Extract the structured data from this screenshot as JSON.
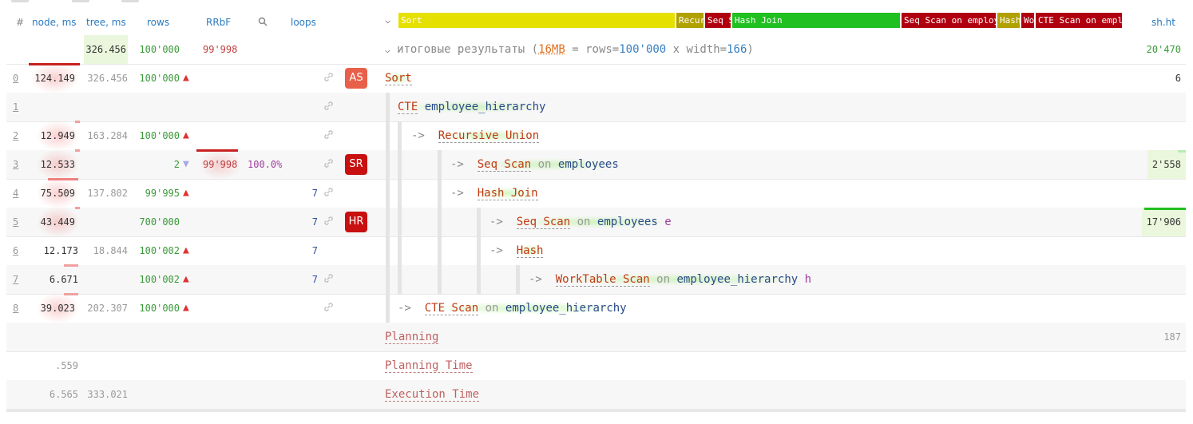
{
  "header": {
    "idx": "#",
    "node_ms": "node, ms",
    "tree_ms": "tree, ms",
    "rows": "rows",
    "rrbf": "RRbF",
    "loops": "loops",
    "shht": "sh.ht"
  },
  "timeline": [
    {
      "label": "Sort",
      "color": "#e6e000"
    },
    {
      "label": "Recur",
      "color": "#b0a000"
    },
    {
      "label": "Seq Scan",
      "color": "#b00010"
    },
    {
      "label": "Hash Join",
      "color": "#20c020"
    },
    {
      "label": "Seq Scan on employees e",
      "color": "#b00010"
    },
    {
      "label": "Hash",
      "color": "#b0a000"
    },
    {
      "label": "WorkTable Scan",
      "color": "#b00010"
    },
    {
      "label": "CTE Scan on employee_hierarchy",
      "color": "#b00010"
    }
  ],
  "summary": {
    "tree": "326.456",
    "rows": "100'000",
    "rrbf": "99'998",
    "text_prefix": "итоговые результаты (",
    "mem": "16MB",
    "eq1": " = rows=",
    "rows_val": "100'000",
    "mul": " x width=",
    "width_val": "166",
    "close": ")",
    "shht": "20'470"
  },
  "rows": [
    {
      "idx": "0",
      "node": "124.149",
      "tree": "326.456",
      "rows": "100'000",
      "dir": "▲",
      "badge": "AS",
      "badge_color": "#e8604a",
      "op": "Sort",
      "shht": "6"
    },
    {
      "idx": "1",
      "op": "CTE",
      "obj": "employee_hierarchy"
    },
    {
      "idx": "2",
      "node": "12.949",
      "tree": "163.284",
      "rows": "100'000",
      "dir": "▲",
      "arrow": "->",
      "op": "Recursive Union"
    },
    {
      "idx": "3",
      "node": "12.533",
      "rows": "2",
      "dir": "▼",
      "rrbf": "99'998",
      "pct": "100.0%",
      "badge": "SR",
      "badge_color": "#c81010",
      "arrow": "->",
      "op": "Seq Scan",
      "kw": "on",
      "obj": "employees",
      "shht": "2'558"
    },
    {
      "idx": "4",
      "node": "75.509",
      "tree": "137.802",
      "rows": "99'995",
      "dir": "▲",
      "loops": "7",
      "arrow": "->",
      "op": "Hash Join"
    },
    {
      "idx": "5",
      "node": "43.449",
      "rows": "700'000",
      "loops": "7",
      "badge": "HR",
      "badge_color": "#c81010",
      "arrow": "->",
      "op": "Seq Scan",
      "kw": "on",
      "obj": "employees",
      "alias": "e",
      "shht": "17'906"
    },
    {
      "idx": "6",
      "node": "12.173",
      "tree": "18.844",
      "rows": "100'002",
      "dir": "▲",
      "loops": "7",
      "arrow": "->",
      "op": "Hash"
    },
    {
      "idx": "7",
      "node": "6.671",
      "rows": "100'002",
      "dir": "▲",
      "loops": "7",
      "arrow": "->",
      "op": "WorkTable Scan",
      "kw": "on",
      "obj": "employee_hierarchy",
      "alias": "h"
    },
    {
      "idx": "8",
      "node": "39.023",
      "tree": "202.307",
      "rows": "100'000",
      "dir": "▲",
      "arrow": "->",
      "op": "CTE Scan",
      "kw": "on",
      "obj": "employee_hierarchy"
    }
  ],
  "footer": [
    {
      "label": "Planning",
      "shht": "187"
    },
    {
      "label": "Planning Time",
      "node": ".559"
    },
    {
      "label": "Execution Time",
      "node": "6.565",
      "tree": "333.021"
    }
  ]
}
